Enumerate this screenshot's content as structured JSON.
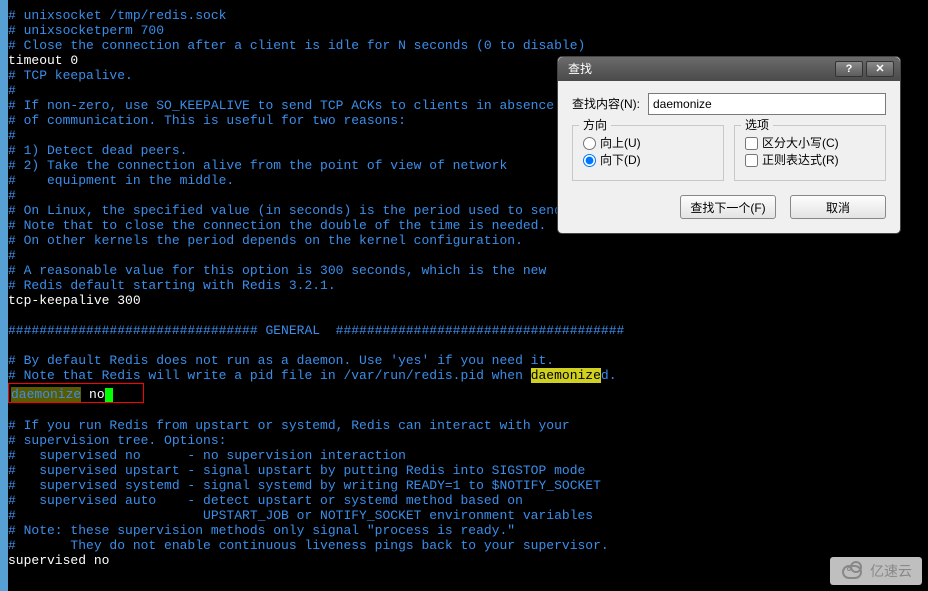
{
  "terminal": {
    "l1": "# unixsocket /tmp/redis.sock",
    "l2": "# unixsocketperm 700",
    "l3": "",
    "l4": "# Close the connection after a client is idle for N seconds (0 to disable)",
    "l5": "timeout 0",
    "l6": "# TCP keepalive.",
    "l7": "#",
    "l8": "# If non-zero, use SO_KEEPALIVE to send TCP ACKs to clients in absence",
    "l9": "# of communication. This is useful for two reasons:",
    "l10": "#",
    "l11": "# 1) Detect dead peers.",
    "l12": "# 2) Take the connection alive from the point of view of network",
    "l13": "#    equipment in the middle.",
    "l14": "#",
    "l15": "# On Linux, the specified value (in seconds) is the period used to send ACKs.",
    "l16": "# Note that to close the connection the double of the time is needed.",
    "l17": "# On other kernels the period depends on the kernel configuration.",
    "l18": "#",
    "l19": "# A reasonable value for this option is 300 seconds, which is the new",
    "l20": "# Redis default starting with Redis 3.2.1.",
    "l21": "tcp-keepalive 300",
    "l22": "",
    "l23": "################################ GENERAL  #####################################",
    "l24": "",
    "l25": "# By default Redis does not run as a daemon. Use 'yes' if you need it.",
    "l26a": "# Note that Redis will write a pid file in /var/run/redis.pid when ",
    "l26b": "daemonize",
    "l26c": "d.",
    "l27a": "daemonize",
    "l27b": " no",
    "l28": "",
    "l29": "# If you run Redis from upstart or systemd, Redis can interact with your",
    "l30": "# supervision tree. Options:",
    "l31": "#   supervised no      - no supervision interaction",
    "l32": "#   supervised upstart - signal upstart by putting Redis into SIGSTOP mode",
    "l33": "#   supervised systemd - signal systemd by writing READY=1 to $NOTIFY_SOCKET",
    "l34": "#   supervised auto    - detect upstart or systemd method based on",
    "l35": "#                        UPSTART_JOB or NOTIFY_SOCKET environment variables",
    "l36": "# Note: these supervision methods only signal \"process is ready.\"",
    "l37": "#       They do not enable continuous liveness pings back to your supervisor.",
    "l38": "supervised no"
  },
  "dialog": {
    "title": "查找",
    "help": "?",
    "close": "✕",
    "search_label": "查找内容(N):",
    "search_value": "daemonize",
    "direction_legend": "方向",
    "radio_up": "向上(U)",
    "radio_down": "向下(D)",
    "options_legend": "选项",
    "check_case": "区分大小写(C)",
    "check_regex": "正则表达式(R)",
    "find_next": "查找下一个(F)",
    "cancel": "取消"
  },
  "watermark": {
    "text": "亿速云"
  }
}
